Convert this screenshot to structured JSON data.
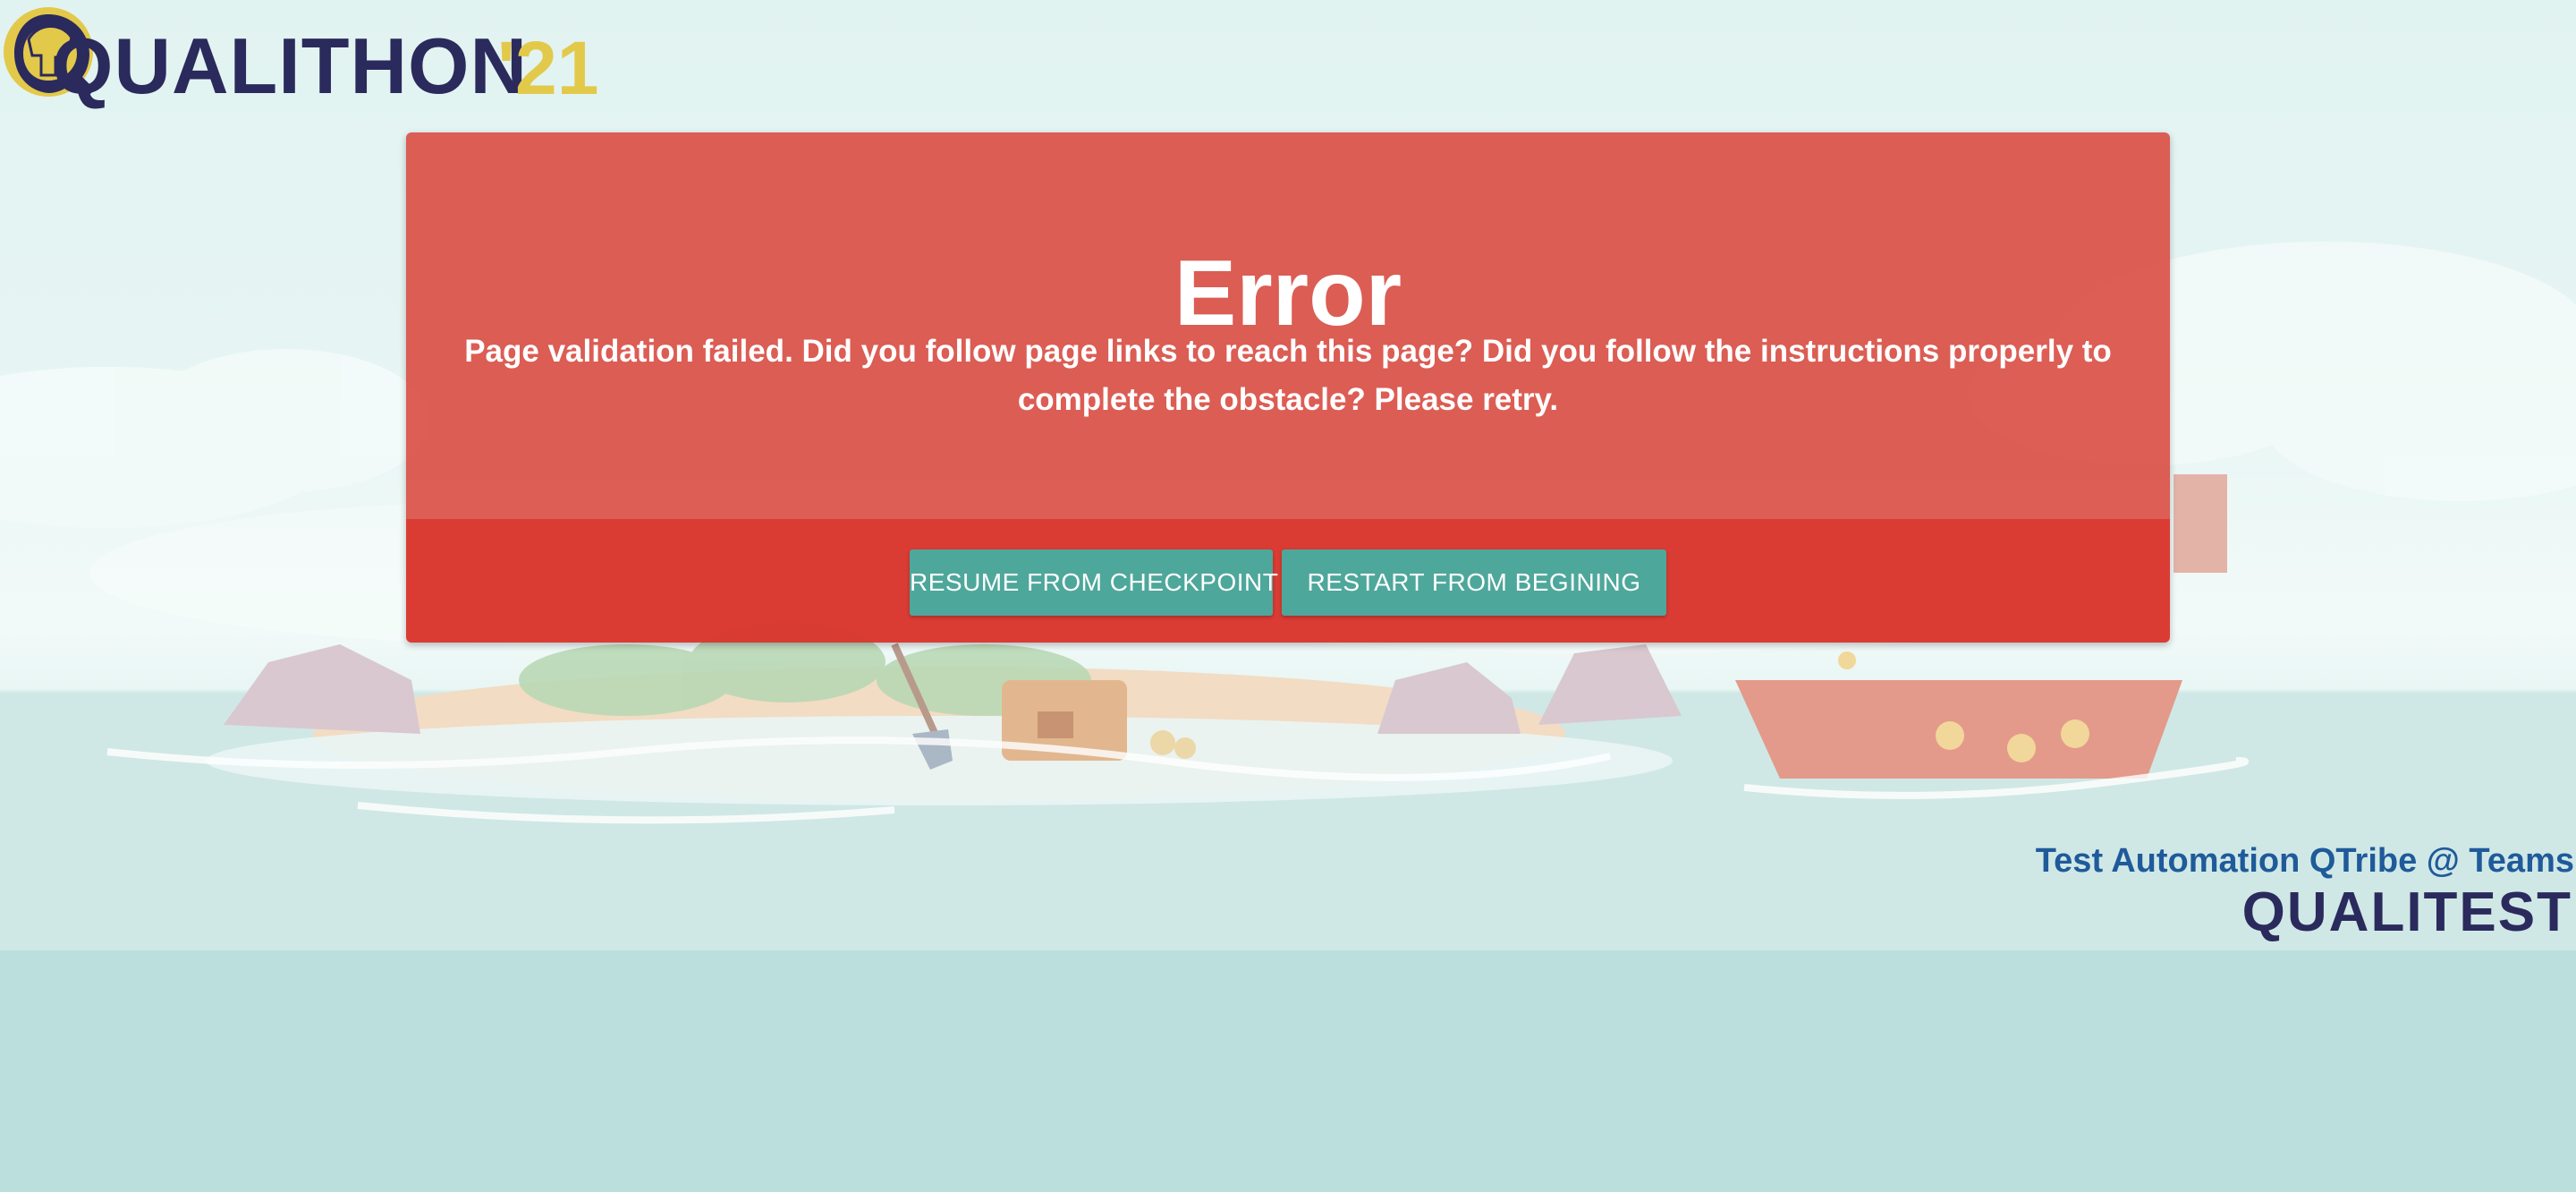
{
  "header": {
    "logo_word": "QUALITHON",
    "logo_year": "'21",
    "logo_icon": "spartan-helmet-icon"
  },
  "error_card": {
    "title": "Error",
    "message": "Page validation failed. Did you follow page links to reach this page? Did you follow the instructions properly to complete the obstacle? Please retry.",
    "buttons": [
      {
        "label": "RESUME FROM CHECKPOINT"
      },
      {
        "label": "RESTART FROM BEGINING"
      }
    ]
  },
  "footer": {
    "tagline": "Test Automation QTribe @ Teams",
    "brand": "QUALITEST"
  },
  "colors": {
    "brand_navy": "#2b2a5c",
    "brand_gold": "#e3c94a",
    "error_red": "#da483e",
    "button_teal": "#4ea79b",
    "tagline_blue": "#1f5a9a"
  }
}
